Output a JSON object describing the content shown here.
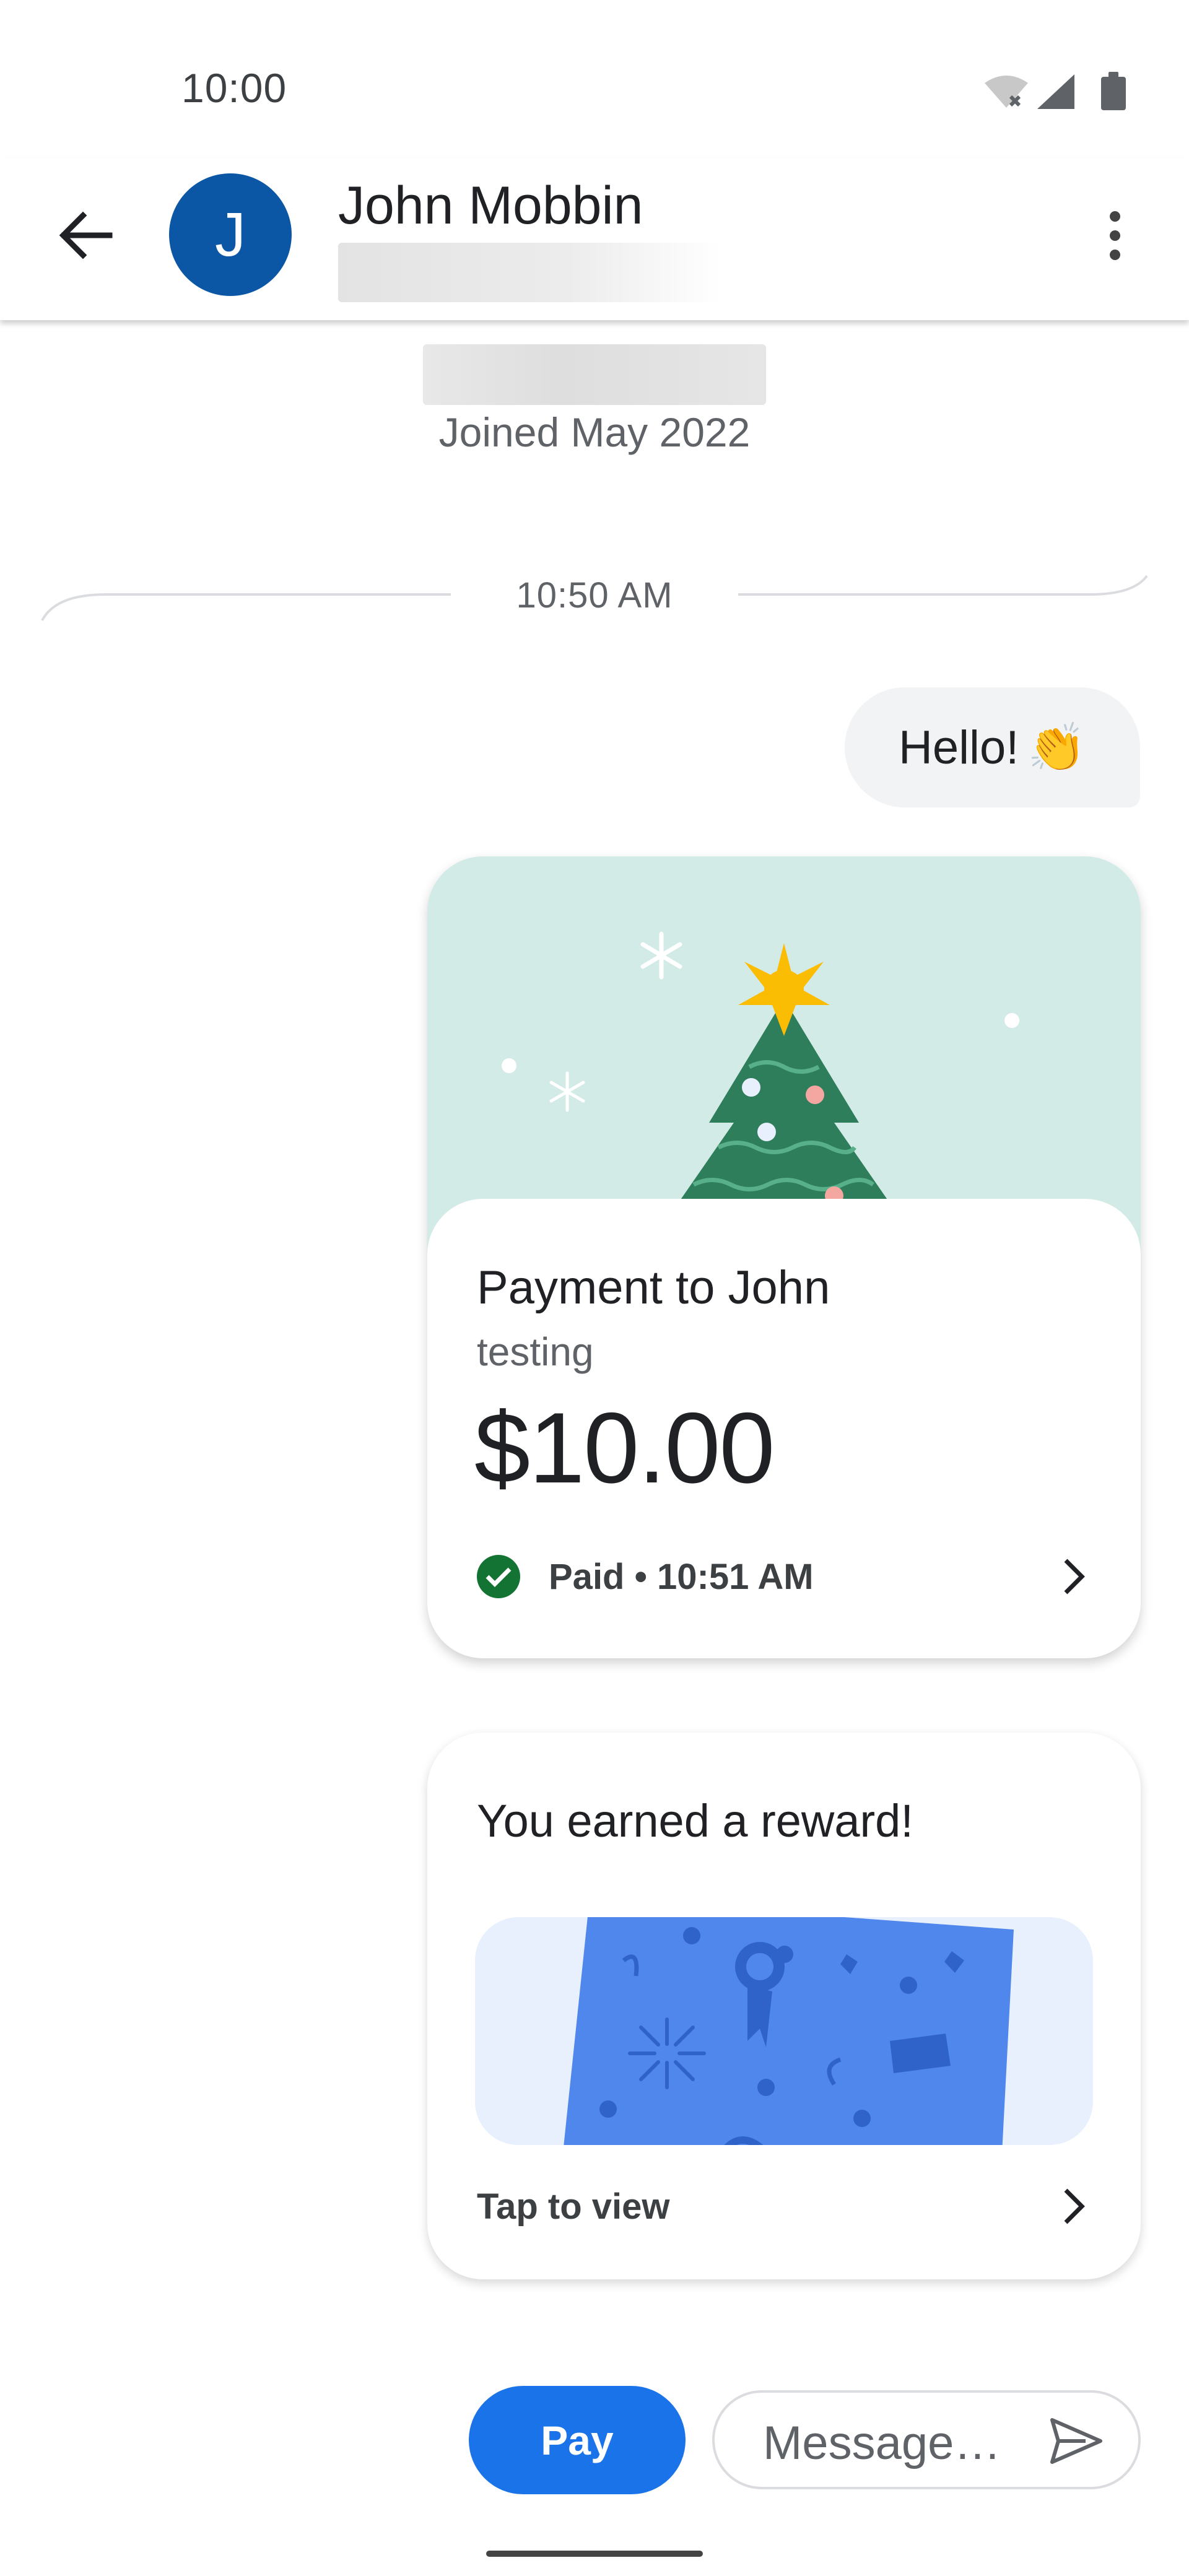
{
  "status_bar": {
    "time": "10:00"
  },
  "header": {
    "contact_name": "John Mobbin",
    "avatar_initial": "J",
    "avatar_color": "#0b57a6"
  },
  "conversation": {
    "joined_text": "Joined May 2022",
    "timestamp": "10:50 AM",
    "message_text": "Hello!",
    "message_emoji": "👏"
  },
  "payment_card": {
    "title": "Payment to John",
    "note": "testing",
    "amount": "$10.00",
    "status": "Paid • 10:51 AM",
    "status_color": "#137333"
  },
  "reward_card": {
    "title": "You earned a reward!",
    "cta": "Tap to view"
  },
  "composer": {
    "pay_label": "Pay",
    "message_placeholder": "Message…",
    "accent": "#1a73e8"
  }
}
